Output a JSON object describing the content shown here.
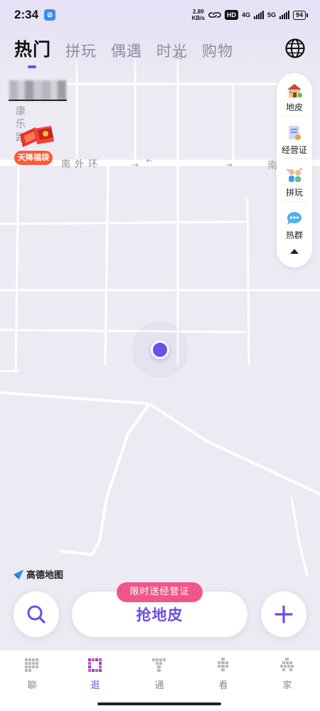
{
  "status_bar": {
    "time": "2:34",
    "speed_value": "2.89",
    "speed_unit": "KB/s",
    "hd_badge": "HD",
    "net1": "4G",
    "net2": "5G",
    "battery": "94"
  },
  "tabs": [
    {
      "label": "热门",
      "active": true
    },
    {
      "label": "拼玩",
      "active": false
    },
    {
      "label": "偶遇",
      "active": false
    },
    {
      "label": "时光",
      "active": false
    },
    {
      "label": "购物",
      "active": false
    }
  ],
  "right_dock": {
    "items": [
      {
        "label": "地皮",
        "icon": "house-icon"
      },
      {
        "label": "经营证",
        "icon": "certificate-icon"
      },
      {
        "label": "拼玩",
        "icon": "players-icon"
      },
      {
        "label": "热群",
        "icon": "chat-bubble-icon"
      }
    ]
  },
  "map": {
    "street_chars": [
      "康",
      "乐",
      "路"
    ],
    "road_name": "南外环",
    "road_name_right": "南",
    "road_label_top": "路",
    "promo_label": "天降福袋",
    "provider": "高德地图"
  },
  "actions": {
    "grab_label": "抢地皮",
    "grab_tag": "限时送经营证"
  },
  "bottom_nav": [
    {
      "label": "聊",
      "active": false
    },
    {
      "label": "逛",
      "active": true
    },
    {
      "label": "通",
      "active": false
    },
    {
      "label": "看",
      "active": false
    },
    {
      "label": "家",
      "active": false
    }
  ],
  "colors": {
    "accent": "#6a4ee8",
    "tag": "#f0568a",
    "promo": "#ff5a33"
  }
}
